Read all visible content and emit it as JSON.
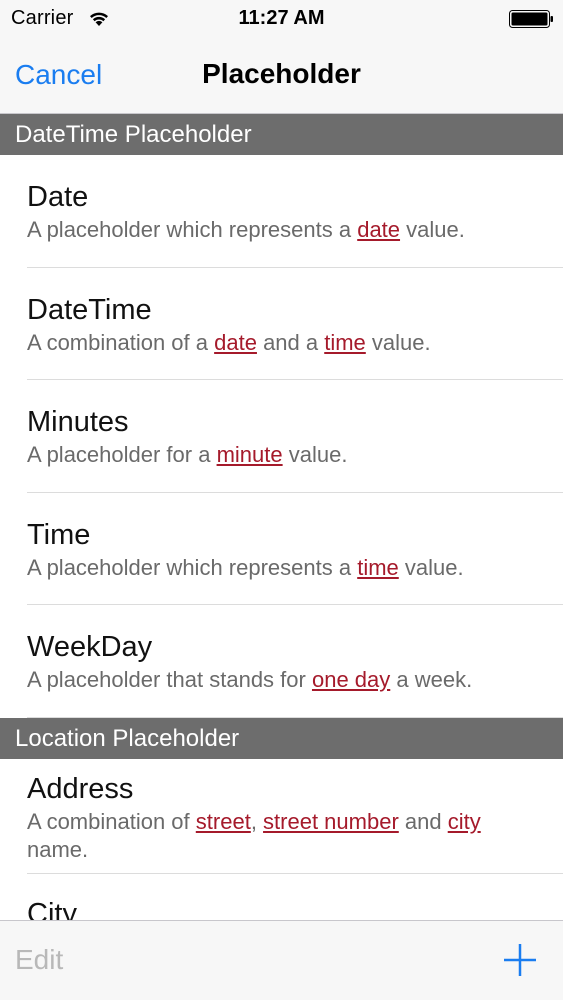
{
  "status_bar": {
    "carrier": "Carrier",
    "time": "11:27 AM",
    "wifi_icon": "wifi-icon",
    "battery_icon": "battery-icon"
  },
  "nav": {
    "cancel_label": "Cancel",
    "title": "Placeholder"
  },
  "sections": [
    {
      "header": "DateTime Placeholder",
      "items": [
        {
          "title": "Date",
          "desc": [
            {
              "t": "A placeholder which represents a "
            },
            {
              "t": "date",
              "link": true
            },
            {
              "t": " value."
            }
          ]
        },
        {
          "title": "DateTime",
          "desc": [
            {
              "t": "A combination of a "
            },
            {
              "t": "date",
              "link": true
            },
            {
              "t": " and a "
            },
            {
              "t": "time",
              "link": true
            },
            {
              "t": " value."
            }
          ]
        },
        {
          "title": "Minutes",
          "desc": [
            {
              "t": "A placeholder for a "
            },
            {
              "t": "minute",
              "link": true
            },
            {
              "t": " value."
            }
          ]
        },
        {
          "title": "Time",
          "desc": [
            {
              "t": "A placeholder which represents a "
            },
            {
              "t": "time",
              "link": true
            },
            {
              "t": " value."
            }
          ]
        },
        {
          "title": "WeekDay",
          "desc": [
            {
              "t": "A placeholder that stands for "
            },
            {
              "t": "one day",
              "link": true
            },
            {
              "t": " a week."
            }
          ]
        }
      ]
    },
    {
      "header": "Location Placeholder",
      "items": [
        {
          "title": "Address",
          "desc": [
            {
              "t": "A combination of "
            },
            {
              "t": "street",
              "link": true
            },
            {
              "t": ", "
            },
            {
              "t": "street number",
              "link": true
            },
            {
              "t": " and "
            },
            {
              "t": "city",
              "link": true
            },
            {
              "t": " name."
            }
          ]
        },
        {
          "title": "City",
          "desc": []
        }
      ]
    }
  ],
  "toolbar": {
    "edit_label": "Edit",
    "add_icon": "plus-icon"
  },
  "colors": {
    "accent": "#1a7df0",
    "link": "#a51a2b",
    "section_header_bg": "#6d6d6d",
    "disabled": "#b8b8b8"
  }
}
